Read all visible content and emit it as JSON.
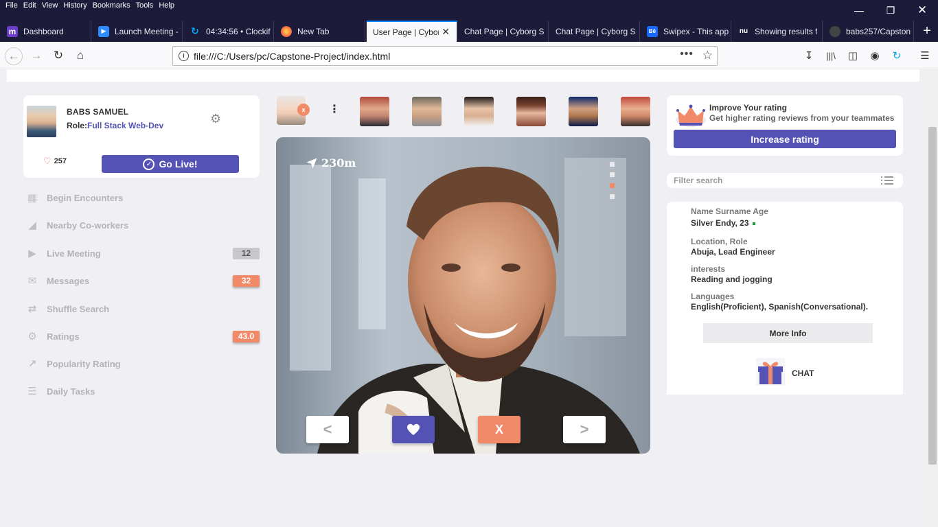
{
  "browser": {
    "menus": [
      "File",
      "Edit",
      "View",
      "History",
      "Bookmarks",
      "Tools",
      "Help"
    ],
    "tabs": [
      {
        "label": "Dashboard",
        "icon": "m",
        "color": "#6a3ec8"
      },
      {
        "label": "Launch Meeting -",
        "icon": "zoom",
        "color": "#2d8cff"
      },
      {
        "label": "04:34:56 • Clockif",
        "icon": "clockify",
        "color": "#03a9f4"
      },
      {
        "label": "New Tab",
        "icon": "firefox",
        "color": "#ff7139"
      },
      {
        "label": "User Page | Cybor",
        "icon": "",
        "color": ""
      },
      {
        "label": "Chat Page | Cyborg S",
        "icon": "",
        "color": ""
      },
      {
        "label": "Chat Page | Cyborg S",
        "icon": "",
        "color": ""
      },
      {
        "label": "Swipex - This app",
        "icon": "Bē",
        "color": "#1769ff"
      },
      {
        "label": "Showing results f",
        "icon": "nu",
        "color": "#1c1b3a"
      },
      {
        "label": "babs257/Capston",
        "icon": "github",
        "color": "#333"
      }
    ],
    "url": "file:///C:/Users/pc/Capstone-Project/index.html"
  },
  "profile": {
    "name": "BABS SAMUEL",
    "role_label": "Role:",
    "role_value": "Full Stack Web-Dev",
    "likes": "257",
    "go_live": "Go Live!"
  },
  "sidebar": {
    "items": [
      {
        "label": "Begin Encounters",
        "icon": "grid-icon",
        "badge": ""
      },
      {
        "label": "Nearby Co-workers",
        "icon": "signal-icon",
        "badge": ""
      },
      {
        "label": "Live Meeting",
        "icon": "play-icon",
        "badge": "12"
      },
      {
        "label": "Messages",
        "icon": "chat-bubbles-icon",
        "badge": "32"
      },
      {
        "label": "Shuffle Search",
        "icon": "shuffle-icon",
        "badge": ""
      },
      {
        "label": "Ratings",
        "icon": "gear-icon",
        "badge": "43.0"
      },
      {
        "label": "Popularity Rating",
        "icon": "chart-icon",
        "badge": ""
      },
      {
        "label": "Daily Tasks",
        "icon": "layers-icon",
        "badge": ""
      }
    ]
  },
  "stories": {
    "close": "x",
    "more": "⋮"
  },
  "card": {
    "distance": "230m",
    "prev": "<",
    "next": ">",
    "nope": "X",
    "pages": 4,
    "active_page": 3
  },
  "rating": {
    "title": "Improve Your rating",
    "subtitle": "Get higher rating reviews from your teammates",
    "button": "Increase rating"
  },
  "filter": {
    "placeholder": "Filter search"
  },
  "info": {
    "name_label": "Name Surname  Age",
    "name_value": "Silver Endy, 23",
    "location_label": "Location, Role",
    "location_value": "Abuja, Lead Engineer",
    "interests_label": "interests",
    "interests_value": "Reading and jogging",
    "languages_label": "Languages",
    "languages_value": "English(Proficient), Spanish(Conversational).",
    "more_info": "More Info",
    "chat": "CHAT"
  },
  "colors": {
    "accent": "#5552b5",
    "orange": "#f08a68",
    "chrome": "#1c1b3a"
  }
}
